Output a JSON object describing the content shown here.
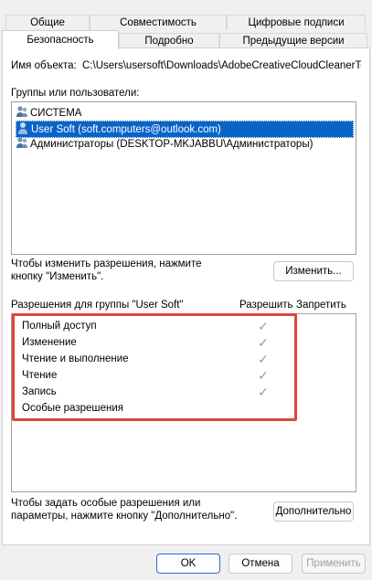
{
  "tabs_row1": [
    "Общие",
    "Совместимость",
    "Цифровые подписи"
  ],
  "tabs_row2": [
    "Безопасность",
    "Подробно",
    "Предыдущие версии"
  ],
  "object_label": "Имя объекта:",
  "object_path": "C:\\Users\\usersoft\\Downloads\\AdobeCreativeCloudCleanerToo",
  "groups_label": "Группы или пользователи:",
  "groups": [
    {
      "label": "СИСТЕМА",
      "icon": "users-group-icon",
      "selected": false
    },
    {
      "label": "User Soft (soft.computers@outlook.com)",
      "icon": "user-icon",
      "selected": true
    },
    {
      "label": "Администраторы (DESKTOP-MKJABBU\\Администраторы)",
      "icon": "users-group-icon",
      "selected": false
    }
  ],
  "change_hint": "Чтобы изменить разрешения, нажмите кнопку \"Изменить\".",
  "change_button": "Изменить...",
  "permissions_header": "Разрешения для группы \"User Soft\"",
  "allow_header": "Разрешить",
  "deny_header": "Запретить",
  "permissions": [
    {
      "label": "Полный доступ",
      "allow": true
    },
    {
      "label": "Изменение",
      "allow": true
    },
    {
      "label": "Чтение и выполнение",
      "allow": true
    },
    {
      "label": "Чтение",
      "allow": true
    },
    {
      "label": "Запись",
      "allow": true
    },
    {
      "label": "Особые разрешения",
      "allow": false
    }
  ],
  "highlight_color": "#e0463a",
  "selection_color": "#0a64c8",
  "advanced_hint": "Чтобы задать особые разрешения или параметры, нажмите кнопку \"Дополнительно\".",
  "advanced_button": "Дополнительно",
  "ok_button": "OK",
  "cancel_button": "Отмена",
  "apply_button": "Применить",
  "check_glyph": "✓"
}
